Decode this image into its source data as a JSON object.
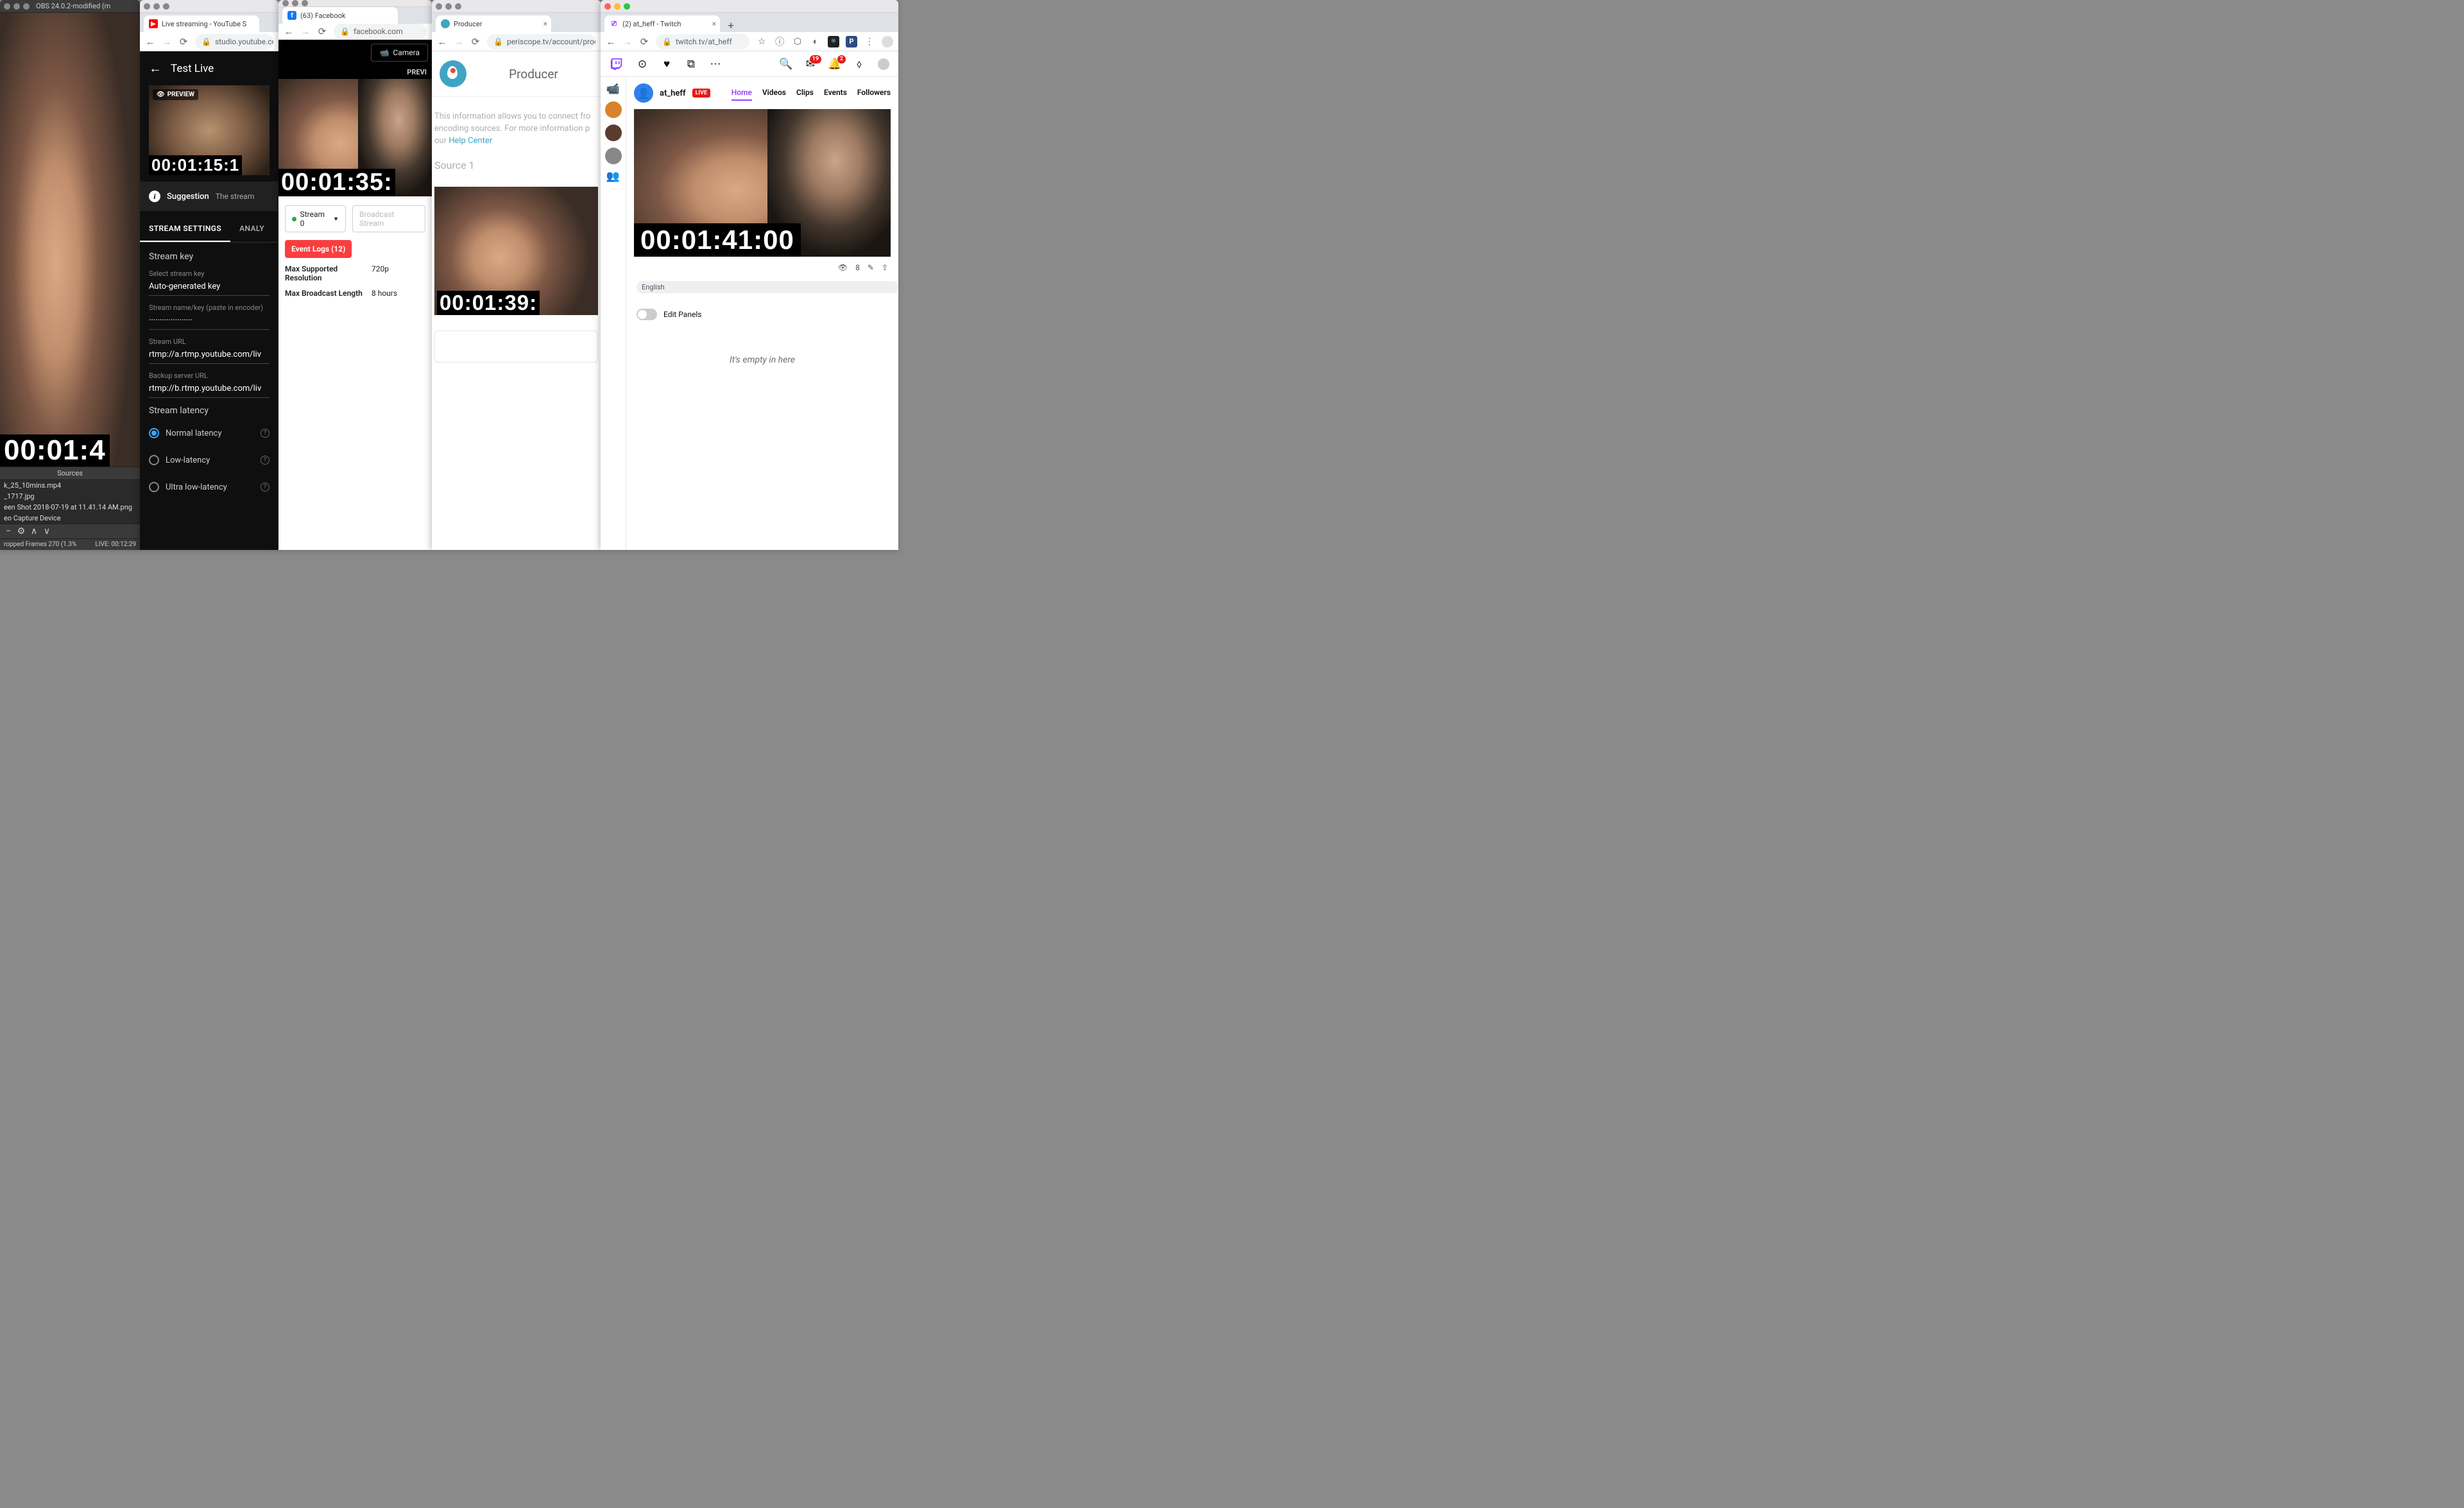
{
  "obs": {
    "title": "OBS 24.0.2-modified (m",
    "timecode": "00:01:4",
    "sources_header": "Sources",
    "sources": [
      "k_25_10mins.mp4",
      "_1717.jpg",
      "een Shot 2018-07-19 at 11.41.14 AM.png",
      "eo Capture Device"
    ],
    "status_left": "ropped Frames 270 (1.3%",
    "status_right": "LIVE: 00:12:29"
  },
  "youtube": {
    "tab_title": "Live streaming - YouTube S",
    "url": "studio.youtube.con",
    "header_title": "Test Live",
    "preview_badge": "PREVIEW",
    "timecode": "00:01:15:1",
    "suggestion_label": "Suggestion",
    "suggestion_text": "The stream",
    "tabs": {
      "settings": "STREAM SETTINGS",
      "analytics": "ANALY"
    },
    "section_key": "Stream key",
    "select_key_label": "Select stream key",
    "select_key_value": "Auto-generated key",
    "streamkey_label": "Stream name/key (paste in encoder)",
    "streamkey_value": "····················",
    "streamurl_label": "Stream URL",
    "streamurl_value": "rtmp://a.rtmp.youtube.com/liv",
    "backup_label": "Backup server URL",
    "backup_value": "rtmp://b.rtmp.youtube.com/liv",
    "latency_header": "Stream latency",
    "latency": {
      "normal": "Normal latency",
      "low": "Low-latency",
      "ultra": "Ultra low-latency"
    }
  },
  "facebook": {
    "tab_title": "(63) Facebook",
    "url": "facebook.com",
    "camera_btn": "Camera",
    "preview_label": "PREVI",
    "timecode": "00:01:35:",
    "stream_selector": "Stream 0",
    "broadcast_btn": "Broadcast Stream",
    "event_logs": "Event Logs (12)",
    "kv1_label": "Max Supported Resolution",
    "kv1_value": "720p",
    "kv2_label": "Max Broadcast Length",
    "kv2_value": "8 hours"
  },
  "periscope": {
    "tab_title": "Producer",
    "url": "periscope.tv/account/produ",
    "header_title": "Producer",
    "info_pre": "This information allows you to connect fro",
    "info_mid": "encoding sources. For more information p",
    "info_our": "our ",
    "info_link": "Help Center",
    "source_label": "Source 1",
    "timecode": "00:01:39:"
  },
  "twitch": {
    "tab_title": "(2) at_heff - Twitch",
    "url": "twitch.tv/at_heff",
    "badge_inbox": "19",
    "badge_notif": "2",
    "username": "at_heff",
    "live_badge": "LIVE",
    "tabs": {
      "home": "Home",
      "videos": "Videos",
      "clips": "Clips",
      "events": "Events",
      "followers": "Followers"
    },
    "timecode": "00:01:41:00",
    "view_count": "8",
    "language": "English",
    "edit_panels": "Edit Panels",
    "empty_msg": "It's empty in here"
  }
}
